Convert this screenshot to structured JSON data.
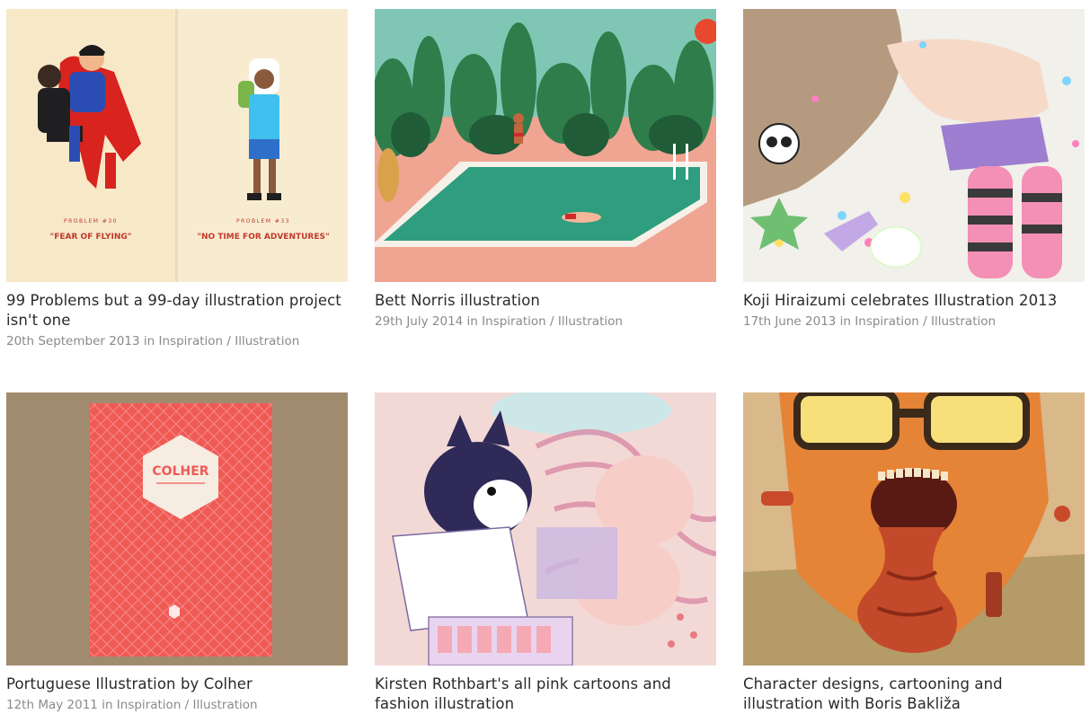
{
  "posts": [
    {
      "title": "99 Problems but a 99-day illustration project isn't one",
      "date": "20th September 2013",
      "in_word": "in",
      "category": "Inspiration",
      "separator": "/",
      "subcategory": "Illustration",
      "image": {
        "left_caption_small": "PROBLEM #30",
        "left_caption": "\"FEAR OF FLYING\"",
        "right_caption_small": "PROBLEM #33",
        "right_caption": "\"NO TIME FOR ADVENTURES\""
      }
    },
    {
      "title": "Bett Norris illustration",
      "date": "29th July 2014",
      "in_word": "in",
      "category": "Inspiration",
      "separator": "/",
      "subcategory": "Illustration"
    },
    {
      "title": "Koji Hiraizumi celebrates Illustration 2013",
      "date": "17th June 2013",
      "in_word": "in",
      "category": "Inspiration",
      "separator": "/",
      "subcategory": "Illustration"
    },
    {
      "title": "Portuguese Illustration by Colher",
      "date": "12th May 2011",
      "in_word": "in",
      "category": "Inspiration",
      "separator": "/",
      "subcategory": "Illustration",
      "image": {
        "book_label": "COLHER"
      }
    },
    {
      "title": "Kirsten Rothbart's all pink cartoons and fashion illustration",
      "date": "",
      "in_word": "",
      "category": "",
      "separator": "",
      "subcategory": ""
    },
    {
      "title": "Character designs, cartooning and illustration with Boris Bakliža",
      "date": "",
      "in_word": "",
      "category": "",
      "separator": "",
      "subcategory": ""
    }
  ],
  "colors": {
    "title": "#2a2a2a",
    "meta": "#8a8a8a",
    "background": "#ffffff"
  }
}
